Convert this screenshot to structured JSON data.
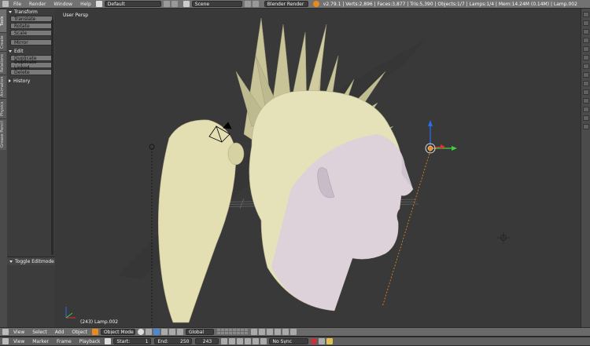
{
  "colors": {
    "accent": "#e98a1d",
    "viewport_bg": "#393939",
    "header_bg": "#727272"
  },
  "top": {
    "menus": [
      "File",
      "Render",
      "Window",
      "Help"
    ],
    "layout": "Default",
    "scene": "Scene",
    "engine": "Blender Render",
    "stats": "v2.79.1 | Verts:2,896 | Faces:3,877 | Tris:5,390 | Objects:1/7 | Lamps:1/4 | Mem:14.24M (0.14M) | Lamp.002"
  },
  "tabs": [
    "Tools",
    "Create",
    "Relations",
    "Animation",
    "Physics",
    "Grease Pencil"
  ],
  "toolshelf": {
    "transform_title": "Transform",
    "translate": "Translate",
    "rotate": "Rotate",
    "scale": "Scale",
    "mirror": "Mirror",
    "edit_title": "Edit",
    "duplicate": "Duplicate",
    "duplicate_linked": "Duplicate Linked",
    "delete": "Delete",
    "history_title": "History",
    "toggle_editmode": "Toggle Editmode"
  },
  "viewport": {
    "perspective_label": "User Persp",
    "object_label": "(243) Lamp.002"
  },
  "header3d": {
    "menus": [
      "View",
      "Select",
      "Add",
      "Object"
    ],
    "mode": "Object Mode",
    "orientation": "Global"
  },
  "timeline": {
    "menus": [
      "View",
      "Marker",
      "Frame",
      "Playback"
    ],
    "start_label": "Start:",
    "start": "1",
    "end_label": "End:",
    "end": "250",
    "current": "243",
    "sync": "No Sync"
  }
}
